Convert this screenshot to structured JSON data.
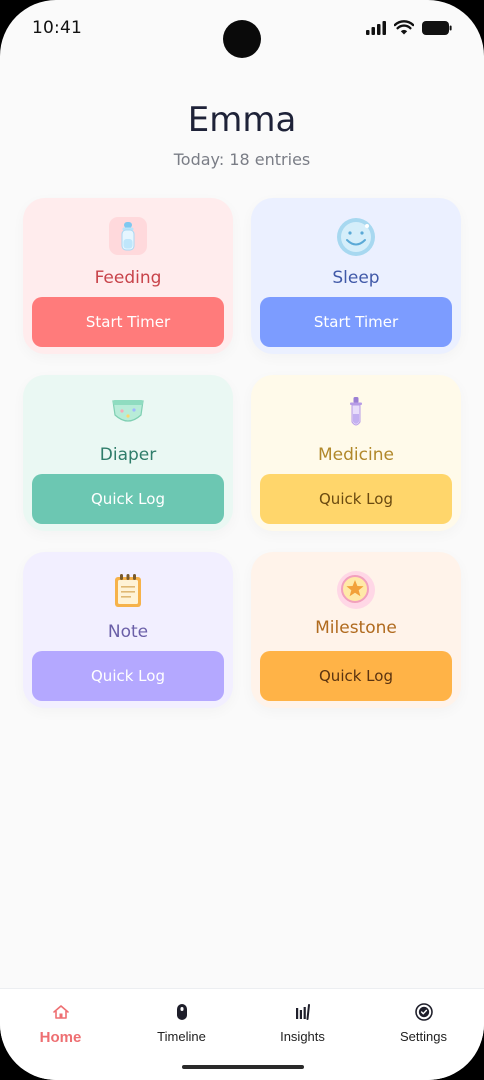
{
  "status_bar": {
    "time": "10:41"
  },
  "header": {
    "child_name": "Emma",
    "entries_summary": "Today: 18 entries"
  },
  "cards": [
    {
      "label": "Feeding",
      "button": "Start Timer",
      "icon": "baby-bottle-icon",
      "bg": "#ffeced",
      "label_color": "#c8434a",
      "button_bg": "#ff7b7b",
      "button_text": "#ffffff"
    },
    {
      "label": "Sleep",
      "button": "Start Timer",
      "icon": "moon-icon",
      "bg": "#ebf0ff",
      "label_color": "#4059a8",
      "button_bg": "#7c9cff",
      "button_text": "#ffffff"
    },
    {
      "label": "Diaper",
      "button": "Quick Log",
      "icon": "diaper-icon",
      "bg": "#eaf8f3",
      "label_color": "#2f7d6a",
      "button_bg": "#6cc7b2",
      "button_text": "#ffffff"
    },
    {
      "label": "Medicine",
      "button": "Quick Log",
      "icon": "medicine-dropper-icon",
      "bg": "#fffaea",
      "label_color": "#b1882a",
      "button_bg": "#ffd66b",
      "button_text": "#6a4a10"
    },
    {
      "label": "Note",
      "button": "Quick Log",
      "icon": "notepad-icon",
      "bg": "#f2efff",
      "label_color": "#6b5fa8",
      "button_bg": "#b4a8ff",
      "button_text": "#ffffff"
    },
    {
      "label": "Milestone",
      "button": "Quick Log",
      "icon": "milestone-star-icon",
      "bg": "#fff3ea",
      "label_color": "#b06a1e",
      "button_bg": "#ffb347",
      "button_text": "#5a3310"
    }
  ],
  "nav": [
    {
      "label": "Home",
      "icon": "home-icon",
      "active": true
    },
    {
      "label": "Timeline",
      "icon": "timeline-icon",
      "active": false
    },
    {
      "label": "Insights",
      "icon": "insights-icon",
      "active": false
    },
    {
      "label": "Settings",
      "icon": "settings-icon",
      "active": false
    }
  ],
  "colors": {
    "accent": "#ee6f72",
    "background": "#fafafa"
  }
}
